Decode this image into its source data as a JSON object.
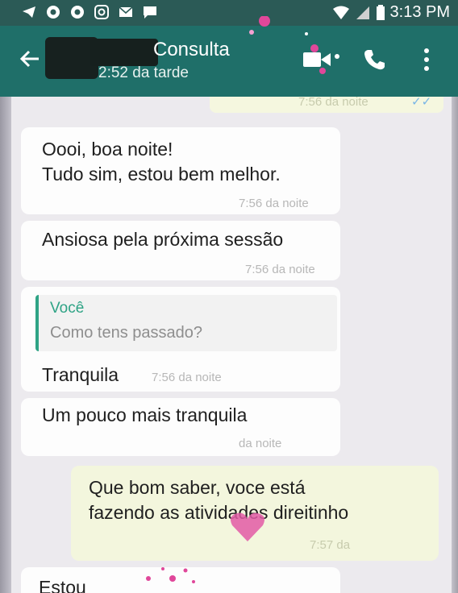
{
  "status_bar": {
    "time": "3:13 PM"
  },
  "header": {
    "contact_name_visible": "Consulta",
    "status": "2:52 da tarde"
  },
  "messages": [
    {
      "direction": "out",
      "time": "7:56 da noite",
      "partial": true
    },
    {
      "direction": "in",
      "text_lines": [
        "Oooi, boa noite!",
        "Tudo sim, estou bem melhor."
      ],
      "time": "7:56 da noite"
    },
    {
      "direction": "in",
      "text_lines": [
        "Ansiosa pela próxima sessão"
      ],
      "time": "7:56 da noite"
    },
    {
      "direction": "in",
      "quote": {
        "author": "Você",
        "text": "Como tens passado?"
      },
      "text_lines": [
        "Tranquila"
      ],
      "time": "7:56 da noite"
    },
    {
      "direction": "in",
      "text_lines": [
        "Um pouco mais tranquila"
      ],
      "time": "da noite"
    },
    {
      "direction": "out",
      "text_lines": [
        "Que bom saber, voce está",
        "fazendo as atividades direitinho"
      ],
      "time": "7:57 da"
    },
    {
      "direction": "in",
      "text_lines": [
        "Estou"
      ],
      "partial": true
    }
  ],
  "colors": {
    "header": "#1f6f69",
    "status_bar": "#2b5a56",
    "quote_accent": "#2ea385",
    "outgoing_bubble": "#f3f6dd",
    "incoming_bubble": "#fdfdfd"
  },
  "icons": [
    "back-arrow-icon",
    "video-call-icon",
    "phone-call-icon",
    "more-options-icon"
  ]
}
